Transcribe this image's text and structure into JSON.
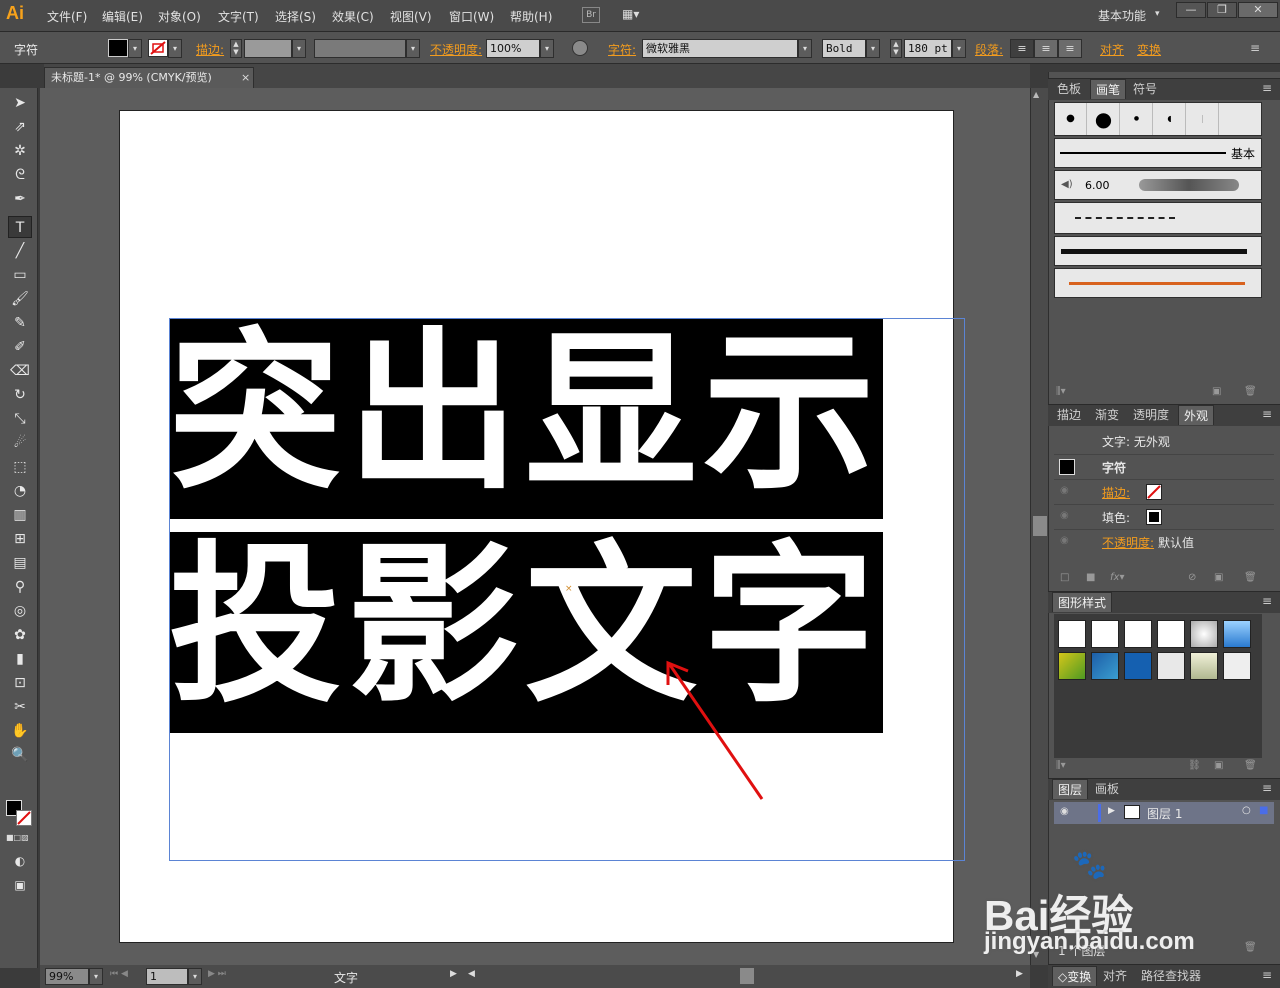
{
  "app": {
    "logo": "Ai"
  },
  "menubar": {
    "items": [
      "文件(F)",
      "编辑(E)",
      "对象(O)",
      "文字(T)",
      "选择(S)",
      "效果(C)",
      "视图(V)",
      "窗口(W)",
      "帮助(H)"
    ],
    "bridge": "Br",
    "workspace": "基本功能",
    "window_controls": [
      "—",
      "❐",
      "✕"
    ]
  },
  "control_bar": {
    "selection_type": "字符",
    "stroke_label": "描边:",
    "opacity_label": "不透明度:",
    "opacity_value": "100%",
    "char_label": "字符:",
    "font_family": "微软雅黑",
    "font_style": "Bold",
    "font_size": "180 pt",
    "paragraph_label": "段落:",
    "align_label": "对齐",
    "transform_label": "变换"
  },
  "document": {
    "tab_title": "未标题-1* @ 99% (CMYK/预览)",
    "close": "×"
  },
  "artwork": {
    "line1": "突出显示",
    "line2": "投影文字"
  },
  "statusbar": {
    "zoom": "99%",
    "page": "1",
    "status_text": "文字"
  },
  "panels": {
    "top_tabs": [
      "色板",
      "画笔",
      "符号"
    ],
    "brushes": {
      "basic_label": "基本",
      "size_value": "6.00"
    },
    "appearance_tabs": [
      "描边",
      "渐变",
      "透明度",
      "外观"
    ],
    "appearance": {
      "header": "文字: 无外观",
      "char_row": "字符",
      "stroke_label": "描边:",
      "fill_label": "填色:",
      "opacity_label": "不透明度:",
      "opacity_value": "默认值"
    },
    "graphic_styles_title": "图形样式",
    "layers_tabs": [
      "图层",
      "画板"
    ],
    "layer_name": "图层 1",
    "layer_count": "1 个图层",
    "bottom_tabs": [
      "变换",
      "对齐",
      "路径查找器"
    ]
  },
  "watermark": {
    "brand": "Bai经验",
    "url": "jingyan.baidu.com"
  },
  "colors": {
    "accent_orange": "#f39c1e",
    "annotation_red": "#e01010",
    "selection_blue": "#5b84d4"
  }
}
